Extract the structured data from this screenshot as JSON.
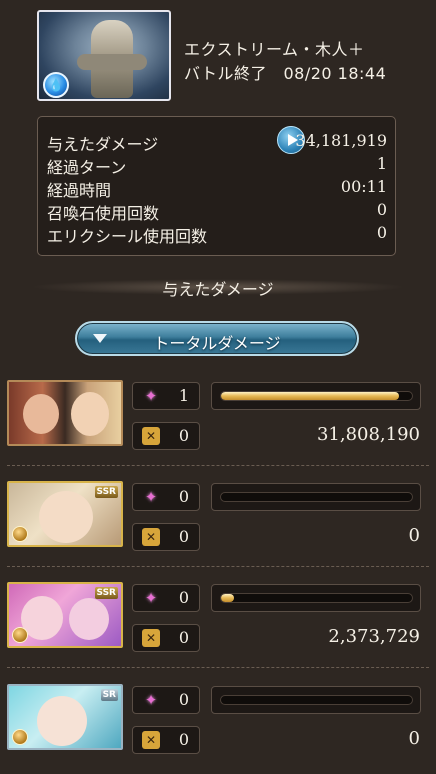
{
  "quest": {
    "title": "エクストリーム・木人＋",
    "subtitle": "バトル終了　08/20 18:44",
    "element_icon": "water-element-icon"
  },
  "stats": {
    "damage_label": "与えたダメージ",
    "damage_value": "34,181,919",
    "turns_label": "経過ターン",
    "turns_value": "1",
    "time_label": "経過時間",
    "time_value": "00:11",
    "summon_label": "召喚石使用回数",
    "summon_value": "0",
    "elixir_label": "エリクシール使用回数",
    "elixir_value": "0"
  },
  "section_title": "与えたダメージ",
  "total_button": "トータルダメージ",
  "characters": [
    {
      "rarity": "",
      "star_count": "1",
      "ougi_count": "0",
      "damage": "31,808,190",
      "bar_fraction": 0.93
    },
    {
      "rarity": "SSR",
      "star_count": "0",
      "ougi_count": "0",
      "damage": "0",
      "bar_fraction": 0.0
    },
    {
      "rarity": "SSR",
      "star_count": "0",
      "ougi_count": "0",
      "damage": "2,373,729",
      "bar_fraction": 0.07
    },
    {
      "rarity": "SR",
      "star_count": "0",
      "ougi_count": "0",
      "damage": "0",
      "bar_fraction": 0.0
    }
  ],
  "colors": {
    "background": "#2e2722",
    "bar_gold": "#e7b955",
    "button_blue": "#3e7e9c",
    "star_pink": "#e76fd2"
  }
}
